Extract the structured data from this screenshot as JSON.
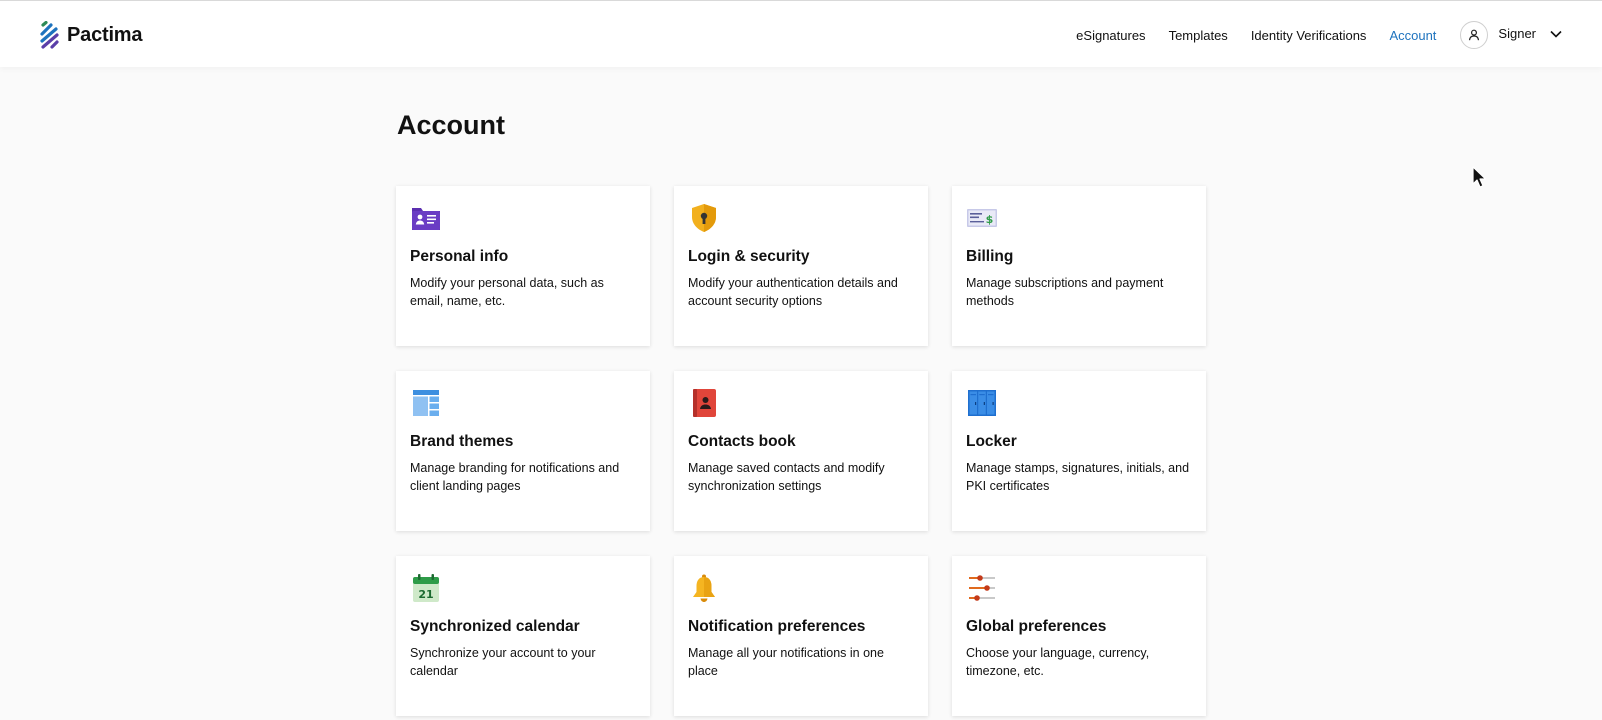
{
  "brand": {
    "name": "Pactima"
  },
  "nav": {
    "items": [
      {
        "label": "eSignatures",
        "active": false
      },
      {
        "label": "Templates",
        "active": false
      },
      {
        "label": "Identity Verifications",
        "active": false
      },
      {
        "label": "Account",
        "active": true
      }
    ],
    "user": {
      "name": "Signer",
      "avatar_icon": "user-icon",
      "menu_icon": "chevron-down-icon"
    }
  },
  "page": {
    "title": "Account"
  },
  "colors": {
    "accent": "#1e73be",
    "background": "#fafafa"
  },
  "cards": [
    {
      "title": "Personal info",
      "description": "Modify your personal data, such as email, name, etc.",
      "icon": "id-card-icon"
    },
    {
      "title": "Login & security",
      "description": "Modify your authentication details and account security options",
      "icon": "shield-lock-icon"
    },
    {
      "title": "Billing",
      "description": "Manage subscriptions and payment methods",
      "icon": "check-money-icon"
    },
    {
      "title": "Brand themes",
      "description": "Manage branding for notifications and client landing pages",
      "icon": "layout-icon"
    },
    {
      "title": "Contacts book",
      "description": "Manage saved contacts and modify synchronization settings",
      "icon": "contacts-book-icon"
    },
    {
      "title": "Locker",
      "description": "Manage stamps, signatures, initials, and PKI certificates",
      "icon": "lockers-icon"
    },
    {
      "title": "Synchronized calendar",
      "description": "Synchronize your account to your calendar",
      "icon": "calendar-icon",
      "icon_text": "21"
    },
    {
      "title": "Notification preferences",
      "description": "Manage all your notifications in one place",
      "icon": "bell-icon"
    },
    {
      "title": "Global preferences",
      "description": "Choose your language, currency, timezone, etc.",
      "icon": "sliders-icon"
    }
  ]
}
